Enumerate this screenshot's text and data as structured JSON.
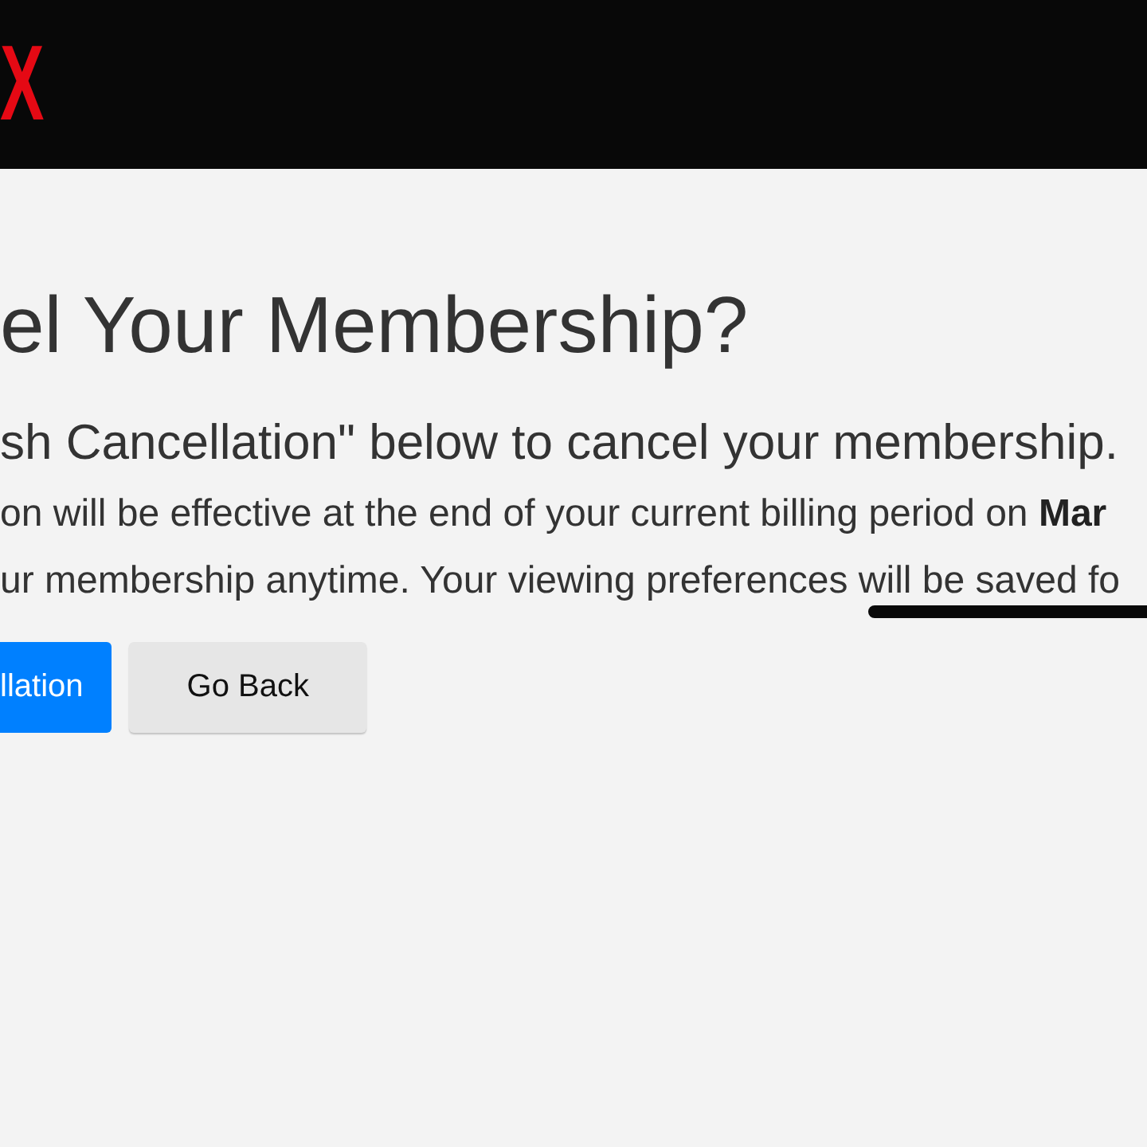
{
  "header": {
    "logo": "X"
  },
  "title": "el Your Membership?",
  "paragraphs": [
    {
      "kind": "lead",
      "text": "sh Cancellation\" below to cancel your membership.",
      "marker_underline": false
    },
    {
      "kind": "body",
      "text": "on will be effective at the end of your current billing period on **Mar**",
      "marker_underline": false
    },
    {
      "kind": "body",
      "text": "ur membership anytime. Your viewing preferences will be saved fo",
      "marker_underline": true
    }
  ],
  "buttons": [
    {
      "label": "llation",
      "kind": "primary"
    },
    {
      "label": "Go Back",
      "kind": "secondary"
    }
  ]
}
